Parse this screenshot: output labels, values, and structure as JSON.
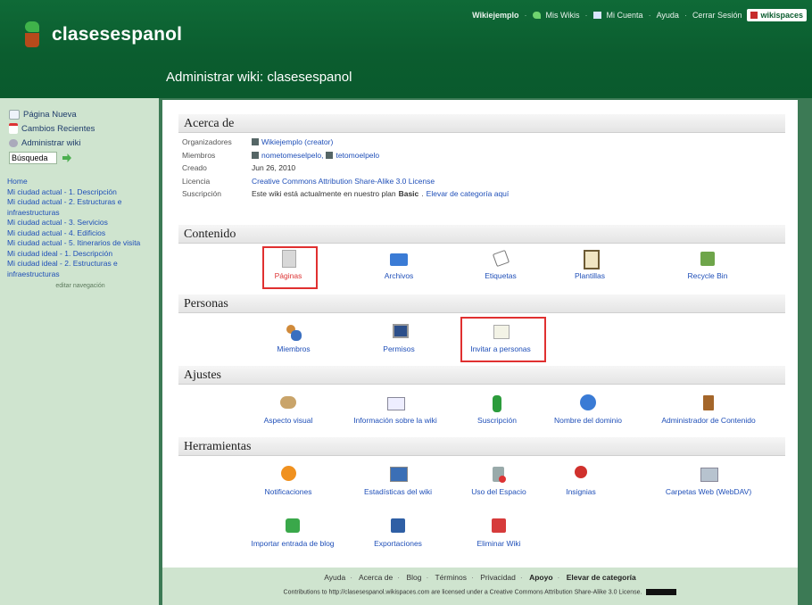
{
  "header": {
    "brand": "clasesespanol",
    "page_title": "Administrar wiki: clasesespanol",
    "topnav": {
      "user": "Wikiejemplo",
      "my_wikis": "Mis Wikis",
      "account": "Mi Cuenta",
      "help": "Ayuda",
      "logout": "Cerrar Sesión",
      "badge": "wikispaces"
    }
  },
  "sidebar": {
    "actions": {
      "new_page": "Página Nueva",
      "recent": "Cambios Recientes",
      "manage": "Administrar wiki",
      "search_value": "Búsqueda"
    },
    "nav": [
      "Home",
      "Mi ciudad actual - 1. Descripción",
      "Mi ciudad actual - 2. Estructuras e infraestructuras",
      "Mi ciudad actual - 3. Servicios",
      "Mi ciudad actual - 4. Edificios",
      "Mi ciudad actual - 5. Itinerarios de visita",
      "Mi ciudad ideal - 1. Descripción",
      "Mi ciudad ideal - 2. Estructuras e infraestructuras"
    ],
    "edit_nav": "editar navegación"
  },
  "about": {
    "heading": "Acerca de",
    "organizers_label": "Organizadores",
    "organizers_value": "Wikiejemplo (creator)",
    "members_label": "Miembros",
    "member1": "nometomeselpelo,",
    "member2": "tetomoelpelo",
    "created_label": "Creado",
    "created_value": "Jun 26, 2010",
    "license_label": "Licencia",
    "license_value": "Creative Commons Attribution Share-Alike 3.0 License",
    "subscription_label": "Suscripción",
    "subscription_text": "Este wiki está actualmente en nuestro plan",
    "subscription_plan": "Basic",
    "upgrade_link": "Elevar de categoría aquí"
  },
  "sections": {
    "content": "Contenido",
    "people": "Personas",
    "settings": "Ajustes",
    "tools": "Herramientas"
  },
  "content_items": [
    "Páginas",
    "Archivos",
    "Etiquetas",
    "Plantillas",
    "Recycle Bin"
  ],
  "people_items": [
    "Miembros",
    "Permisos",
    "Invitar a personas"
  ],
  "settings_items": [
    "Aspecto visual",
    "Información sobre la wiki",
    "Suscripción",
    "Nombre del dominio",
    "Administrador de Contenido"
  ],
  "tools_items": [
    "Notificaciones",
    "Estadísticas del wiki",
    "Uso del Espacio",
    "Insignias",
    "Carpetas Web (WebDAV)",
    "Importar entrada de blog",
    "Exportaciones",
    "Eliminar Wiki"
  ],
  "footer": {
    "links": [
      "Ayuda",
      "Acerca de",
      "Blog",
      "Términos",
      "Privacidad",
      "Apoyo",
      "Elevar de categoría"
    ],
    "license": "Contributions to http://clasesespanol.wikispaces.com are licensed under a Creative Commons Attribution Share-Alike 3.0 License."
  },
  "colors": {
    "header_green": "#0b5d2f",
    "sidebar_green": "#cfe4cf",
    "link_blue": "#1f4fb8",
    "highlight_red": "#e03030"
  }
}
